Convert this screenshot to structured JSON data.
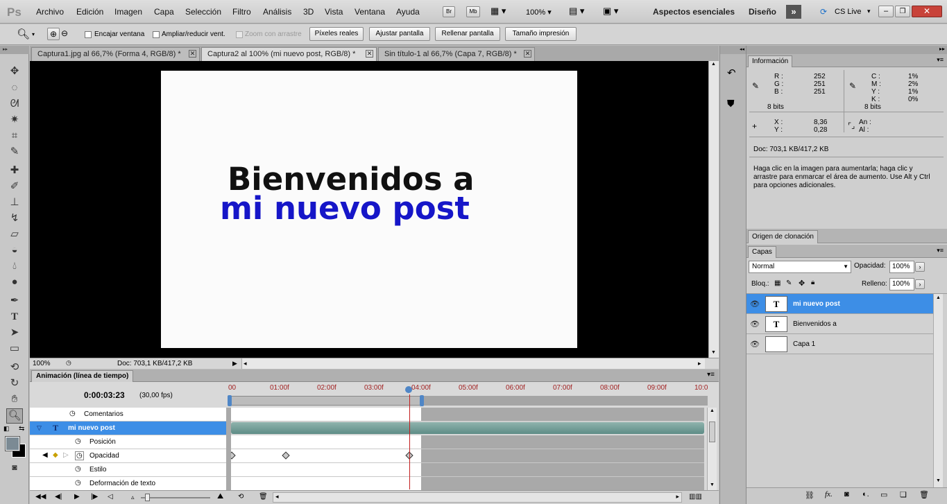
{
  "menubar": {
    "logo": "Ps",
    "items": [
      "Archivo",
      "Edición",
      "Imagen",
      "Capa",
      "Selección",
      "Filtro",
      "Análisis",
      "3D",
      "Vista",
      "Ventana",
      "Ayuda"
    ],
    "br": "Br",
    "mb": "Mb",
    "zoom": "100%",
    "workspaces": [
      "Aspectos esenciales",
      "Diseño"
    ],
    "cslive": "CS Live"
  },
  "options": {
    "encajar": "Encajar ventana",
    "ampliar": "Ampliar/reducir vent.",
    "zoomarrastre": "Zoom con arrastre",
    "buttons": [
      "Píxeles reales",
      "Ajustar pantalla",
      "Rellenar pantalla",
      "Tamaño impresión"
    ]
  },
  "tabs": [
    "Captura1.jpg al 66,7% (Forma 4, RGB/8) *",
    "Captura2 al 100% (mi nuevo post, RGB/8) *",
    "Sin título-1 al 66,7% (Capa 7, RGB/8) *"
  ],
  "canvas": {
    "line1": "Bienvenidos a",
    "line2": "mi nuevo post"
  },
  "status": {
    "zoom": "100%",
    "doc": "Doc: 703,1 KB/417,2 KB"
  },
  "animation": {
    "title": "Animación (línea de tiempo)",
    "time": "0:00:03:23",
    "fps": "(30,00 fps)",
    "ruler": [
      "00",
      "01:00f",
      "02:00f",
      "03:00f",
      "04:00f",
      "05:00f",
      "06:00f",
      "07:00f",
      "08:00f",
      "09:00f",
      "10:0"
    ],
    "rows": [
      "Comentarios",
      "mi nuevo post",
      "Posición",
      "Opacidad",
      "Estilo",
      "Deformación de texto"
    ]
  },
  "info": {
    "title": "Información",
    "r": "R :",
    "g": "G :",
    "b": "B :",
    "rv": "252",
    "gv": "251",
    "bv": "251",
    "c": "C :",
    "m": "M :",
    "y": "Y :",
    "k": "K :",
    "cv": "1%",
    "mv": "2%",
    "yv": "1%",
    "kv": "0%",
    "bits1": "8 bits",
    "bits2": "8 bits",
    "x": "X :",
    "yl": "Y :",
    "xv": "8,36",
    "yv2": "0,28",
    "an": "An :",
    "al": "Al :",
    "doc": "Doc: 703,1 KB/417,2 KB",
    "help": "Haga clic en la imagen para aumentarla; haga clic y arrastre para enmarcar el área de aumento. Use Alt y Ctrl para opciones adicionales."
  },
  "clone": {
    "title": "Origen de clonación"
  },
  "layers": {
    "title": "Capas",
    "blend": "Normal",
    "opacity_label": "Opacidad:",
    "opacity": "100%",
    "lock_label": "Bloq.:",
    "fill_label": "Relleno:",
    "fill": "100%",
    "items": [
      "mi nuevo post",
      "Bienvenidos a",
      "Capa 1"
    ]
  }
}
